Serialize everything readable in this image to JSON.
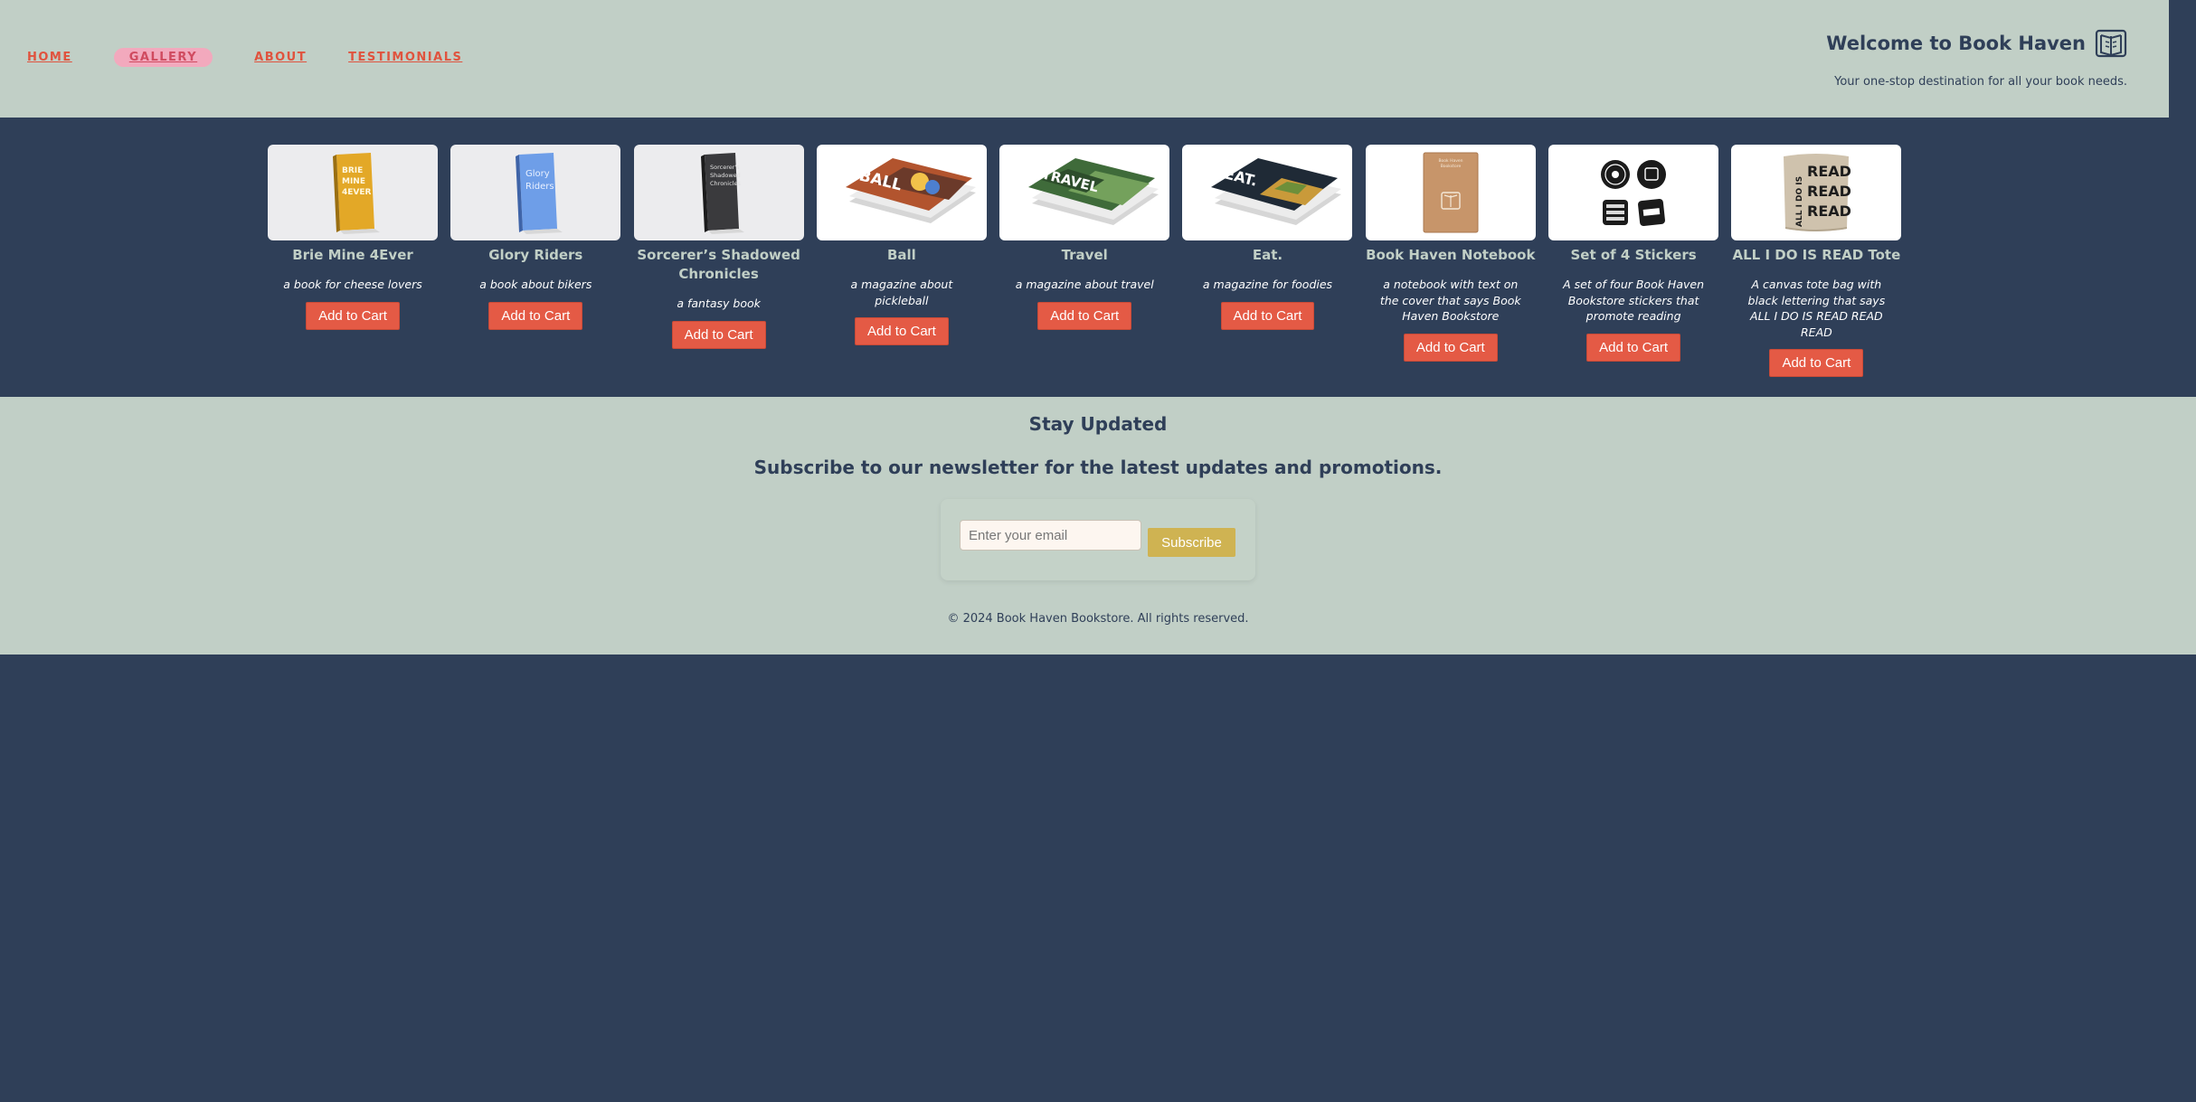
{
  "nav": {
    "items": [
      {
        "label": "HOME"
      },
      {
        "label": "GALLERY"
      },
      {
        "label": "ABOUT"
      },
      {
        "label": "TESTIMONIALS"
      }
    ],
    "active": "GALLERY"
  },
  "brand": {
    "title": "Welcome to Book Haven",
    "logo_icon": "open-book-logo-icon",
    "tagline": "Your one-stop destination for all your book needs."
  },
  "products": [
    {
      "title": "Brie Mine 4Ever",
      "desc": "a book for cheese lovers",
      "button": "Add to Cart",
      "image": "yellow-book-cover",
      "cover_text": "BRIE MINE 4EVER"
    },
    {
      "title": "Glory Riders",
      "desc": "a book about bikers",
      "button": "Add to Cart",
      "image": "blue-book-cover",
      "cover_text": "Glory Riders"
    },
    {
      "title": "Sorcerer’s Shadowed Chronicles",
      "desc": "a fantasy book",
      "button": "Add to Cart",
      "image": "dark-book-cover",
      "cover_text": "Sorcerer's Shadowed Chronicles"
    },
    {
      "title": "Ball",
      "desc": "a magazine about pickleball",
      "button": "Add to Cart",
      "image": "ball-magazine-stack",
      "cover_text": "BALL"
    },
    {
      "title": "Travel",
      "desc": "a magazine about travel",
      "button": "Add to Cart",
      "image": "travel-magazine-stack",
      "cover_text": "TRAVEL"
    },
    {
      "title": "Eat.",
      "desc": "a magazine for foodies",
      "button": "Add to Cart",
      "image": "eat-magazine-stack",
      "cover_text": "EAT."
    },
    {
      "title": "Book Haven Notebook",
      "desc": "a notebook with text on the cover that says Book Haven Bookstore",
      "button": "Add to Cart",
      "image": "kraft-notebook",
      "cover_text": "Book Haven Bookstore"
    },
    {
      "title": "Set of 4 Stickers",
      "desc": "A set of four Book Haven Bookstore stickers that promote reading",
      "button": "Add to Cart",
      "image": "sticker-set"
    },
    {
      "title": "ALL I DO IS READ Tote",
      "desc": "A canvas tote bag with black lettering that says ALL I DO IS READ READ READ",
      "button": "Add to Cart",
      "image": "canvas-tote",
      "cover_text": "ALL I DO IS READ READ READ"
    }
  ],
  "newsletter": {
    "heading": "Stay Updated",
    "subheading": "Subscribe to our newsletter for the latest updates and promotions.",
    "email_placeholder": "Enter your email",
    "button": "Subscribe"
  },
  "footer": {
    "copyright": "© 2024 Book Haven Bookstore. All rights reserved."
  },
  "colors": {
    "header_bg": "#c1cfc6",
    "page_bg": "#2f3f58",
    "accent": "#e45a45",
    "subscribe": "#cfb352",
    "active_pill": "#f2a9bd"
  }
}
